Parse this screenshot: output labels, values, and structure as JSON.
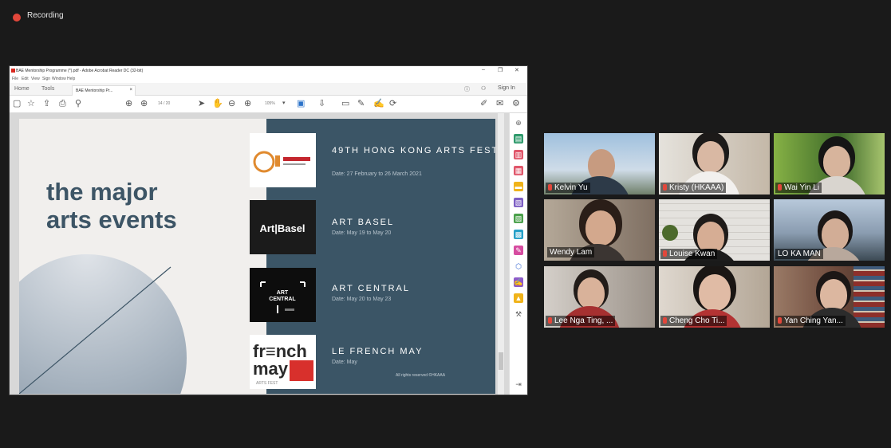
{
  "recording": {
    "label": "Recording"
  },
  "acrobat": {
    "title": "BAE Mentorship Programme (*).pdf - Adobe Acrobat Reader DC (32-bit)",
    "window_controls": [
      "–",
      "❐",
      "✕"
    ],
    "menu": [
      "File",
      "Edit",
      "View",
      "Sign",
      "Window",
      "Help"
    ],
    "tabs": {
      "home": "Home",
      "tools": "Tools",
      "doc_tab": "BAE Mentorship Pr..."
    },
    "sign_in": "Sign In",
    "toolbar": {
      "page_indicator": "14 / 20",
      "zoom": "105%"
    },
    "colors": {
      "accent": "#d9281f",
      "slide_panel": "#3b5566",
      "headline": "#3d5566"
    }
  },
  "slide": {
    "headline": "the major\narts events",
    "events": [
      {
        "title": "49TH HONG KONG\nARTS FESTIVAL",
        "date": "Date: 27 February to 26 March 2021",
        "logo": "hkaf-logo"
      },
      {
        "title": "ART BASEL",
        "date": "Date: May 19 to May 20",
        "logo": "art-basel-logo"
      },
      {
        "title": "ART CENTRAL",
        "date": "Date: May 20 to May 23",
        "logo": "art-central-logo"
      },
      {
        "title": "LE FRENCH MAY",
        "date": "Date: May",
        "logo": "french-may-logo"
      }
    ],
    "rights": "All rights reserved ©HKAAA"
  },
  "gallery": {
    "participants": [
      {
        "name": "Kelvin Yu",
        "active": false,
        "bg": "#6b8eb0"
      },
      {
        "name": "Kristy (HKAAA)",
        "active": false,
        "bg": "#c9c2b8"
      },
      {
        "name": "Wai Yin Li",
        "active": false,
        "bg": "#6a8d3e"
      },
      {
        "name": "Wendy Lam",
        "active": true,
        "bg": "#8a7a6e"
      },
      {
        "name": "Louise Kwan",
        "active": false,
        "bg": "#d8d6d2"
      },
      {
        "name": "LO KA MAN",
        "active": false,
        "bg": "#7f94a8"
      },
      {
        "name": "Lee Nga Ting, ...",
        "active": false,
        "bg": "#b7b1a9"
      },
      {
        "name": "Cheng Cho Ti...",
        "active": false,
        "bg": "#c9bfb3"
      },
      {
        "name": "Yan Ching Yan...",
        "active": false,
        "bg": "#8b6a58"
      }
    ],
    "active_color": "#cddc4a"
  }
}
